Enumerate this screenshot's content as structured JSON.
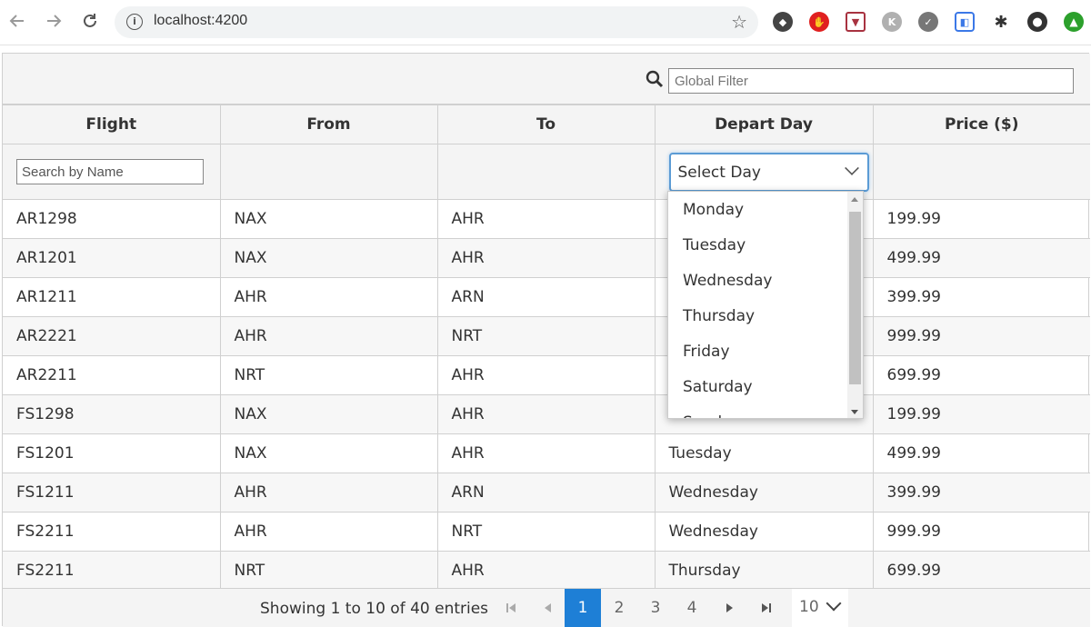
{
  "browser": {
    "url": "localhost:4200",
    "back_icon": "arrow-left-icon",
    "forward_icon": "arrow-right-icon",
    "reload_icon": "reload-icon",
    "extension_colors": [
      "#444444",
      "#e02020",
      "#a83240",
      "#b0b0b0",
      "#777777",
      "#3b78e7",
      "#333333",
      "#333333",
      "#2ca02c"
    ]
  },
  "toolbar": {
    "global_filter_placeholder": "Global Filter",
    "search_icon": "search-icon"
  },
  "columns": [
    "Flight",
    "From",
    "To",
    "Depart Day",
    "Price ($)"
  ],
  "filters": {
    "name_placeholder": "Search by Name",
    "day_select_label": "Select Day"
  },
  "rows": [
    {
      "flight": "AR1298",
      "from": "NAX",
      "to": "AHR",
      "day": "",
      "price": "199.99"
    },
    {
      "flight": "AR1201",
      "from": "NAX",
      "to": "AHR",
      "day": "",
      "price": "499.99"
    },
    {
      "flight": "AR1211",
      "from": "AHR",
      "to": "ARN",
      "day": "",
      "price": "399.99"
    },
    {
      "flight": "AR2221",
      "from": "AHR",
      "to": "NRT",
      "day": "",
      "price": "999.99"
    },
    {
      "flight": "AR2211",
      "from": "NRT",
      "to": "AHR",
      "day": "",
      "price": "699.99"
    },
    {
      "flight": "FS1298",
      "from": "NAX",
      "to": "AHR",
      "day": "",
      "price": "199.99"
    },
    {
      "flight": "FS1201",
      "from": "NAX",
      "to": "AHR",
      "day": "Tuesday",
      "price": "499.99"
    },
    {
      "flight": "FS1211",
      "from": "AHR",
      "to": "ARN",
      "day": "Wednesday",
      "price": "399.99"
    },
    {
      "flight": "FS2211",
      "from": "AHR",
      "to": "NRT",
      "day": "Wednesday",
      "price": "999.99"
    },
    {
      "flight": "FS2211",
      "from": "NRT",
      "to": "AHR",
      "day": "Thursday",
      "price": "699.99"
    }
  ],
  "dropdown": {
    "options": [
      "Monday",
      "Tuesday",
      "Wednesday",
      "Thursday",
      "Friday",
      "Saturday",
      "Sunday"
    ]
  },
  "paginator": {
    "report": "Showing 1 to 10 of 40 entries",
    "pages": [
      "1",
      "2",
      "3",
      "4"
    ],
    "active_page": "1",
    "rows_per_page": "10"
  },
  "colors": {
    "accent": "#1e7fd6",
    "header_bg": "#f4f4f4",
    "select_focus": "#5b9bd5"
  }
}
